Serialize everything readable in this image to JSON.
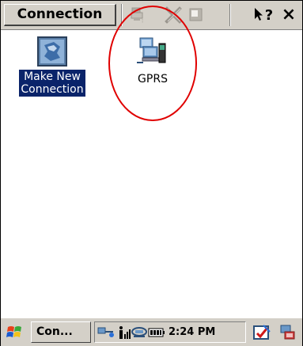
{
  "toolbar": {
    "title": "Connection",
    "buttons": [
      {
        "name": "properties-icon",
        "enabled": false
      },
      {
        "name": "delete-icon",
        "enabled": false
      },
      {
        "name": "rename-icon",
        "enabled": false
      },
      {
        "name": "help-icon",
        "enabled": true
      },
      {
        "name": "close-icon",
        "enabled": true
      }
    ],
    "help_label": "?",
    "close_label": "×"
  },
  "desktop": {
    "items": [
      {
        "label_line1": "Make New",
        "label_line2": "Connection",
        "icon": "make-new-connection-icon",
        "selected": true
      },
      {
        "label_line1": "GPRS",
        "icon": "gprs-connection-icon",
        "selected": false
      }
    ],
    "annotation_color": "#e00000"
  },
  "taskbar": {
    "start_icon": "windows-flag-icon",
    "task_label": "Con...",
    "tray_icons": [
      "network-icon",
      "signal-icon",
      "connection-icon",
      "battery-icon"
    ],
    "clock": "2:24 PM",
    "right_icons": [
      "input-panel-icon",
      "desktop-icon"
    ]
  },
  "colors": {
    "selection": "#0a246a",
    "chrome": "#d4d0c8"
  }
}
